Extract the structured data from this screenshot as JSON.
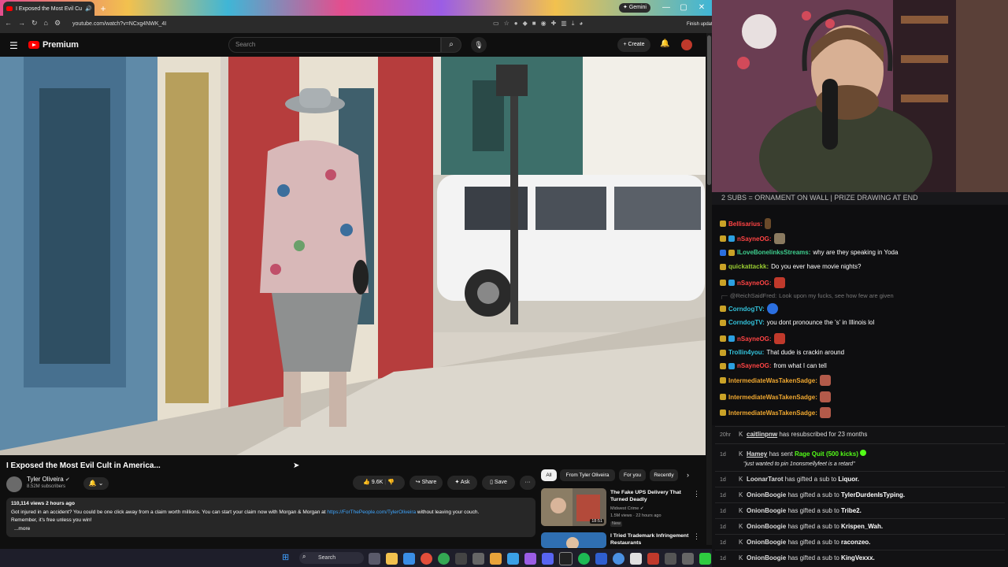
{
  "browser": {
    "tab_title": "I Exposed the Most Evil Cu",
    "url": "youtube.com/watch?v=NCxg4NWK_4I",
    "gemini_label": "Gemini",
    "finish_update": "Finish update",
    "new_tab": "+"
  },
  "youtube": {
    "logo_text": "Premium",
    "search_placeholder": "Search",
    "create_label": "+ Create",
    "video_title": "I Exposed the Most Evil Cult in America...",
    "channel_name": "Tyler Oliveira",
    "channel_subs": "8.52M subscribers",
    "likes": "9.6K",
    "share": "Share",
    "ask": "Ask",
    "save": "Save",
    "more": "···",
    "desc_meta": "110,114 views  2 hours ago",
    "desc_line1_a": "Got injured in an accident? You could be one click away from a claim worth millions. You can start your claim now with Morgan & Morgan at ",
    "desc_link": "https://ForThePeople.com/TylerOliveira",
    "desc_line1_b": " without leaving your couch.",
    "desc_line2": "Remember, it's free unless you win!",
    "desc_more": "...more",
    "chips": [
      "All",
      "From Tyler Oliveira",
      "For you",
      "Recently"
    ],
    "recs": [
      {
        "title": "The Fake UPS Delivery That Turned Deadly",
        "channel": "Midwest Crime",
        "meta": "1.5M views · 22 hours ago",
        "badge": "New",
        "duration": "18:51"
      },
      {
        "title": "I Tried Trademark Infringement Restaurants",
        "channel": "",
        "meta": "",
        "badge": "",
        "duration": ""
      }
    ]
  },
  "taskbar": {
    "search_label": "Search"
  },
  "stream": {
    "banner": "2 SUBS = ORNAMENT ON WALL | PRIZE DRAWING AT END",
    "chat": [
      {
        "user": "Bellisarius:",
        "msg": "",
        "color": "#ff4444"
      },
      {
        "user": "nSayneOG:",
        "msg": "",
        "color": "#ff4444"
      },
      {
        "user": "ILoveBonelinksStreams:",
        "msg": "why are they speaking in Yoda",
        "color": "#3ecf8e"
      },
      {
        "user": "quickattackk:",
        "msg": "Do you ever have movie nights?",
        "color": "#9acd32"
      },
      {
        "user": "nSayneOG:",
        "msg": "",
        "color": "#ff4444"
      },
      {
        "user": "@ReichSaidFred:",
        "msg": "Look upon my fucks, see how few are given",
        "color": "#777777"
      },
      {
        "user": "CorndogTV:",
        "msg": "",
        "color": "#33c1d9"
      },
      {
        "user": "CorndogTV:",
        "msg": "you dont pronounce the 's' in Illinois lol",
        "color": "#33c1d9"
      },
      {
        "user": "nSayneOG:",
        "msg": "",
        "color": "#ff4444"
      },
      {
        "user": "Trollin4you:",
        "msg": "That dude is crackin around",
        "color": "#33c1d9"
      },
      {
        "user": "nSayneOG:",
        "msg": "from what I can tell",
        "color": "#ff4444"
      },
      {
        "user": "IntermediateWasTakenSadge:",
        "msg": "",
        "color": "#f0a830"
      },
      {
        "user": "IntermediateWasTakenSadge:",
        "msg": "",
        "color": "#f0a830"
      },
      {
        "user": "IntermediateWasTakenSadge:",
        "msg": "",
        "color": "#f0a830"
      }
    ],
    "events": [
      {
        "time": "20hr",
        "user": "caitlinpnw",
        "text": " has resubscribed for 23 months",
        "bold": "",
        "tail": ""
      },
      {
        "time": "1d",
        "user": "Hamey",
        "text": " has sent ",
        "bold": "Rage Quit (500 kicks)",
        "tail": ""
      },
      {
        "time": "",
        "user": "",
        "text": "\"just wanted to pin 1nonsmellyfeet is a retard\"",
        "bold": "",
        "tail": ""
      },
      {
        "time": "1d",
        "user": "LoonarTarot",
        "text": " has gifted a sub to ",
        "bold": "Liquor.",
        "tail": ""
      },
      {
        "time": "1d",
        "user": "OnionBoogie",
        "text": " has gifted a sub to ",
        "bold": "TylerDurdenIsTyping.",
        "tail": ""
      },
      {
        "time": "1d",
        "user": "OnionBoogie",
        "text": " has gifted a sub to ",
        "bold": "Tribe2.",
        "tail": ""
      },
      {
        "time": "1d",
        "user": "OnionBoogie",
        "text": " has gifted a sub to ",
        "bold": "Krispen_Wah.",
        "tail": ""
      },
      {
        "time": "1d",
        "user": "OnionBoogie",
        "text": " has gifted a sub to ",
        "bold": "raconzeo.",
        "tail": ""
      },
      {
        "time": "1d",
        "user": "OnionBoogie",
        "text": " has gifted a sub to ",
        "bold": "KingVexxx.",
        "tail": ""
      }
    ]
  }
}
